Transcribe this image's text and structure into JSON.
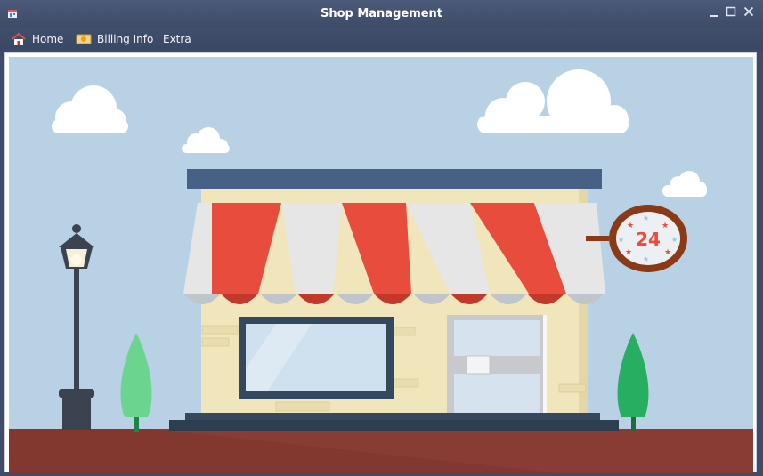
{
  "window": {
    "title": "Shop Management",
    "controls": [
      "minimize",
      "maximize",
      "close"
    ]
  },
  "menu": {
    "items": [
      {
        "label": "Home",
        "icon": "house-icon"
      },
      {
        "label": "Billing Info",
        "icon": "money-icon"
      },
      {
        "label": "Extra",
        "icon": ""
      }
    ]
  },
  "scene": {
    "sign_text": "24",
    "colors": {
      "sky": "#b8d1e4",
      "ground": "#82382f",
      "awning_red": "#e74c3c",
      "awning_white": "#e6e6e6",
      "wall": "#f1e5bb",
      "roof": "#34495e",
      "tree_light": "#6bd48f",
      "tree_dark": "#27ae60"
    }
  }
}
